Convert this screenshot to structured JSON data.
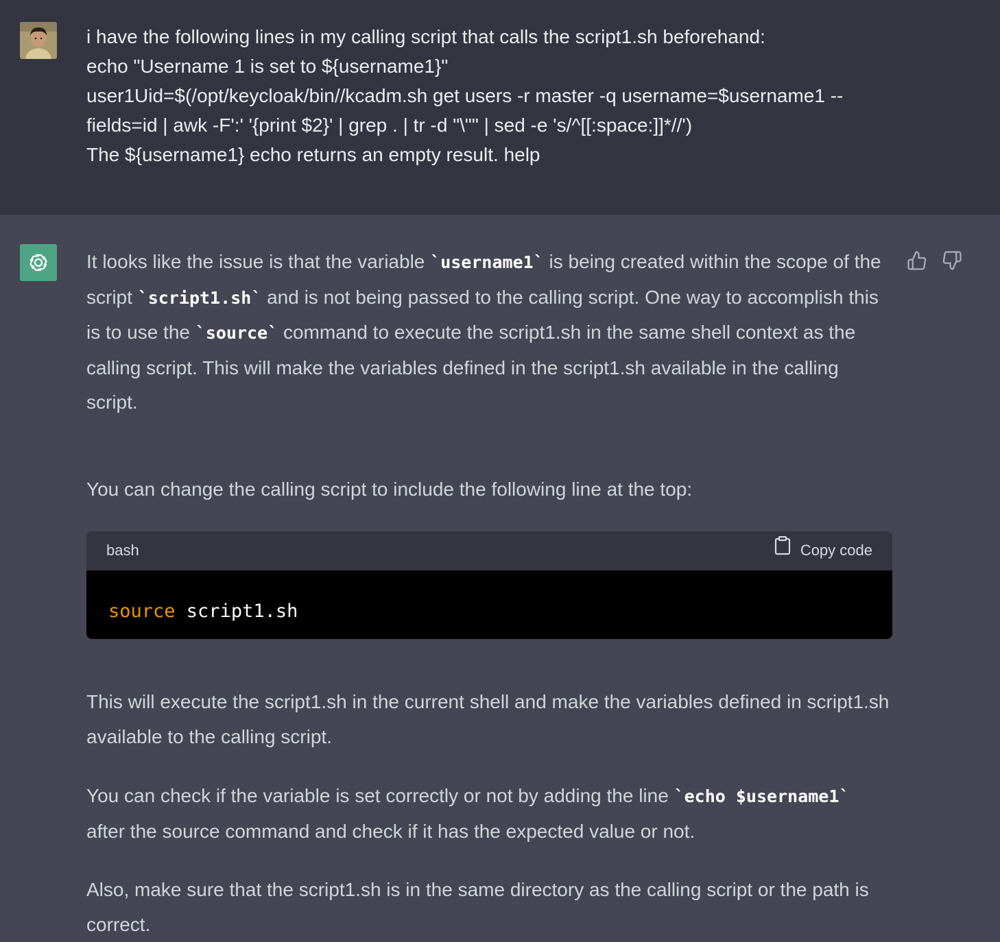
{
  "user_message": {
    "lines": [
      "i have the following lines in my calling script that calls the script1.sh beforehand:",
      "echo \"Username 1 is set to ${username1}\"",
      "user1Uid=$(/opt/keycloak/bin//kcadm.sh get users -r master -q username=$username1 --",
      "fields=id | awk -F':' '{print $2}' | grep . | tr -d \"\\\"\" | sed -e 's/^[[:space:]]*//')",
      "The ${username1} echo returns an empty result. help"
    ]
  },
  "assistant_message": {
    "p1": {
      "t1": "It looks like the issue is that the variable ",
      "c1": "`username1`",
      "t2": " is being created within the scope of the script ",
      "c2": "`script1.sh`",
      "t3": " and is not being passed to the calling script. One way to accomplish this is to use the ",
      "c3": "`source`",
      "t4": " command to execute the script1.sh in the same shell context as the calling script. This will make the variables defined in the script1.sh available in the calling script."
    },
    "p2": "You can change the calling script to include the following line at the top:",
    "code_block": {
      "language": "bash",
      "copy_label": "Copy code",
      "keyword": "source",
      "rest": " script1.sh"
    },
    "p3": "This will execute the script1.sh in the current shell and make the variables defined in script1.sh available to the calling script.",
    "p4": {
      "t1": "You can check if the variable is set correctly or not by adding the line ",
      "c1": "`echo $username1`",
      "t2": " after the source command and check if it has the expected value or not."
    },
    "p5": "Also, make sure that the script1.sh is in the same directory as the calling script or the path is correct."
  },
  "icons": {
    "user_avatar": "user-avatar",
    "bot_avatar": "openai-logo-icon",
    "thumbs_up": "thumbs-up-icon",
    "thumbs_down": "thumbs-down-icon",
    "copy": "clipboard-icon"
  },
  "colors": {
    "user_bg": "#343541",
    "assistant_bg": "#444654",
    "bot_avatar_bg": "#4ea585",
    "code_keyword": "#e9950c"
  }
}
